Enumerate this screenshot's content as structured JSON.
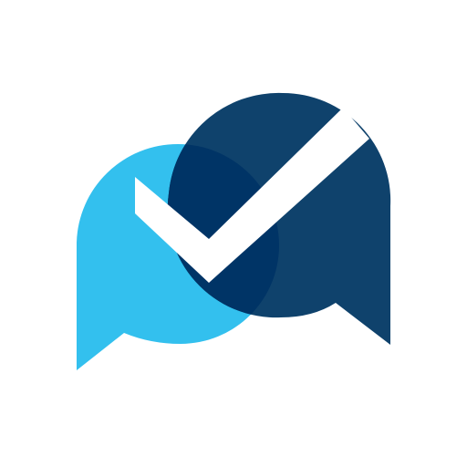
{
  "logo": {
    "icon_name": "chat-bubbles-checkmark-icon",
    "colors": {
      "background": "#ffffff",
      "light_bubble": "#33c0ee",
      "dark_bubble": "#0f426c",
      "overlap": "#003466",
      "checkmark": "#ffffff"
    }
  }
}
